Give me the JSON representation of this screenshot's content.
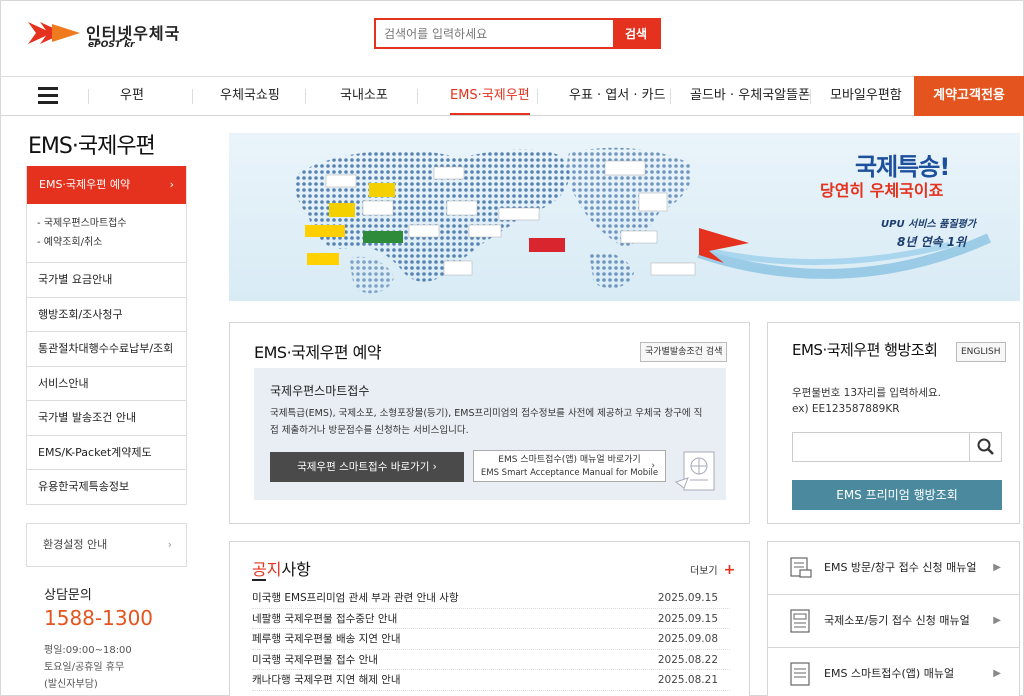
{
  "brand": {
    "name": "인터넷우체국",
    "sub": "ePOST kr",
    "color": "#e4321e"
  },
  "search": {
    "placeholder": "검색어를 입력하세요",
    "button": "검색"
  },
  "gnb": {
    "items": [
      "우편",
      "우체국쇼핑",
      "국내소포",
      "EMS·국제우편",
      "우표 · 엽서 · 카드",
      "골드바 · 우체국알뜰폰",
      "모바일우편함"
    ],
    "corp": "계약고객전용"
  },
  "lnb": {
    "title": "EMS·국제우편",
    "active": "EMS·국제우편 예약",
    "sub": [
      "-  국제우편스마트접수",
      "-  예약조회/취소"
    ],
    "items": [
      "국가별 요금안내",
      "행방조회/조사청구",
      "통관절차대행수수료납부/조회",
      "서비스안내",
      "국가별 발송조건 안내",
      "EMS/K-Packet계약제도",
      "유용한국제특송정보"
    ],
    "env": "환경설정 안내"
  },
  "cs": {
    "title": "상담문의",
    "phone": "1588-1300",
    "hours": [
      "평일:09:00~18:00",
      "토요일/공휴일 휴무",
      "(발신자부담)"
    ]
  },
  "banner": {
    "title1": "국제특송!",
    "title2": "당연히 우체국이죠",
    "line3": "UPU 서비스 품질평가",
    "line4": "8년 연속 1위"
  },
  "reservation": {
    "title": "EMS·국제우편 예약",
    "country_btn": "국가별발송조건 검색",
    "panel_title": "국제우편스마트접수",
    "panel_desc": "국제특급(EMS), 국제소포, 소형포장물(등기), EMS프리미엄의 접수정보를 사전에 제공하고 우체국 창구에 직접 제출하거나 방문접수를 신청하는 서비스입니다.",
    "btn_primary": "국제우편 스마트접수 바로가기  ›",
    "btn_app1": "EMS 스마트접수(앱) 매뉴얼 바로가기",
    "btn_app2": "EMS Smart Acceptance Manual for Mobile"
  },
  "tracking": {
    "title": "EMS·국제우편 행방조회",
    "english": "ENGLISH",
    "info1": "우편물번호 13자리를 입력하세요.",
    "info2": "ex) EE123587889KR",
    "premium": "EMS 프리미엄 행방조회"
  },
  "notice": {
    "title_red": "공지",
    "title_rest": "사항",
    "more": "더보기",
    "items": [
      {
        "title": "미국행 EMS프리미엄 관세 부과 관련 안내 사항",
        "date": "2025.09.15"
      },
      {
        "title": "네팔행 국제우편물 접수중단 안내",
        "date": "2025.09.15"
      },
      {
        "title": "페루행 국제우편물 배송 지연 안내",
        "date": "2025.09.08"
      },
      {
        "title": "미국행 국제우편물 접수 안내",
        "date": "2025.08.22"
      },
      {
        "title": "캐나다행 국제우편 지연 해제 안내",
        "date": "2025.08.21"
      }
    ]
  },
  "manuals": [
    {
      "label": "EMS 방문/창구 접수 신청 매뉴얼",
      "icon": "truck-doc-icon"
    },
    {
      "label": "국제소포/등기 접수 신청 매뉴얼",
      "icon": "form-icon"
    },
    {
      "label": "EMS 스마트접수(앱) 매뉴얼",
      "icon": "list-icon"
    }
  ]
}
